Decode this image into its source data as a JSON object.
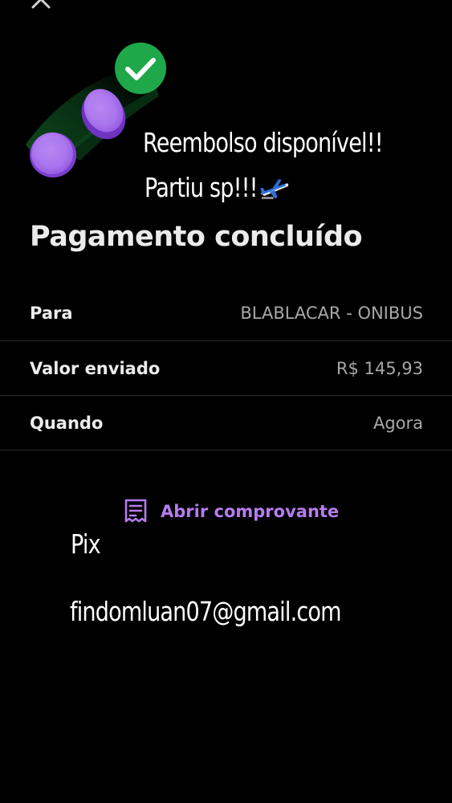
{
  "header": {
    "close_icon": "close-icon"
  },
  "illustration": {
    "coin_color": "#9b5de5",
    "check_color": "#1fa64a",
    "icons": [
      "coin-icon",
      "check-circle-icon"
    ]
  },
  "overlay": {
    "caption_line_1": "Reembolso disponível!!",
    "caption_line_2": "Partiu sp!!!",
    "caption_emoji": "airplane-icon",
    "pix_label": "Pix",
    "pix_key": "findomluan07@gmail.com"
  },
  "main": {
    "title": "Pagamento concluído",
    "details": [
      {
        "label": "Para",
        "value": "BLABLACAR - ONIBUS"
      },
      {
        "label": "Valor enviado",
        "value": "R$ 145,93"
      },
      {
        "label": "Quando",
        "value": "Agora"
      }
    ],
    "receipt_link": {
      "label": "Abrir comprovante",
      "icon": "receipt-icon",
      "color": "#b57cf0"
    }
  }
}
